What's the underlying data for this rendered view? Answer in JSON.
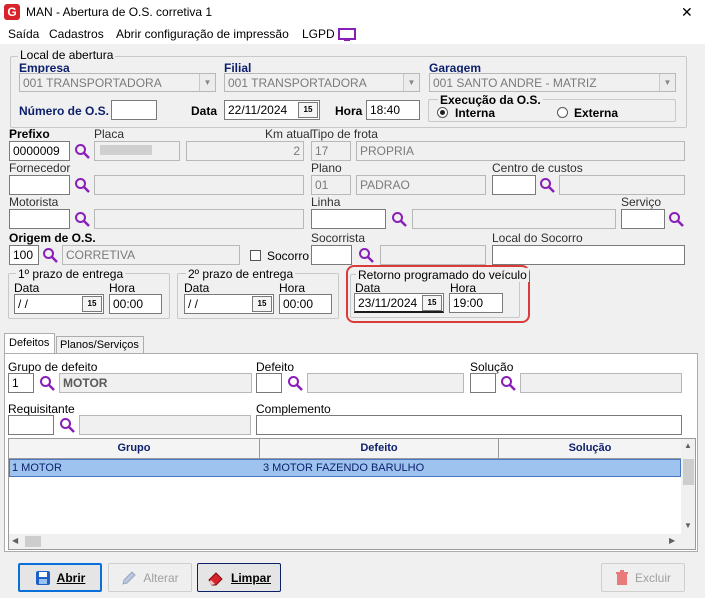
{
  "window": {
    "title": "MAN - Abertura de O.S. corretiva 1",
    "close": "✕"
  },
  "menu": [
    "Saída",
    "Cadastros",
    "Abrir configuração de impressão",
    "LGPD"
  ],
  "local": {
    "title": "Local de abertura",
    "empresa_label": "Empresa",
    "empresa_value": "001 TRANSPORTADORA",
    "filial_label": "Filial",
    "filial_value": "001 TRANSPORTADORA",
    "garagem_label": "Garagem",
    "garagem_value": "001 SANTO ANDRE - MATRIZ",
    "numero_label": "Número de O.S.",
    "numero_value": "",
    "data_label": "Data",
    "data_value": "22/11/2024",
    "hora_label": "Hora",
    "hora_value": "18:40",
    "execucao_title": "Execução da O.S.",
    "interna": "Interna",
    "externa": "Externa"
  },
  "vehicle": {
    "prefixo_label": "Prefixo",
    "prefixo_value": "0000009",
    "placa_label": "Placa",
    "placa_value": "",
    "km_label": "Km atual",
    "km_value": "2",
    "tipo_label": "Tipo de frota",
    "tipo_code": "17",
    "tipo_value": "PROPRIA",
    "fornecedor_label": "Fornecedor",
    "plano_label": "Plano",
    "plano_code": "01",
    "plano_value": "PADRAO",
    "centro_label": "Centro de custos",
    "motorista_label": "Motorista",
    "linha_label": "Linha",
    "servico_label": "Serviço",
    "origem_label": "Origem de O.S.",
    "origem_code": "100",
    "origem_value": "CORRETIVA",
    "socorro_label": "Socorro",
    "socorrista_label": "Socorrista",
    "local_socorro_label": "Local do Socorro"
  },
  "prazos": {
    "p1_title": "1º prazo de entrega",
    "p2_title": "2º prazo de entrega",
    "retorno_title": "Retorno programado do veículo",
    "data_label": "Data",
    "hora_label": "Hora",
    "p1_data": " / /",
    "p1_hora": "00:00",
    "p2_data": " / /",
    "p2_hora": "00:00",
    "ret_data": "23/11/2024",
    "ret_hora": "19:00",
    "cal": "15"
  },
  "tabs": [
    "Defeitos",
    "Planos/Serviços"
  ],
  "defeitos": {
    "grupo_label": "Grupo de defeito",
    "grupo_code": "1",
    "grupo_value": "MOTOR",
    "defeito_label": "Defeito",
    "solucao_label": "Solução",
    "requisitante_label": "Requisitante",
    "complemento_label": "Complemento",
    "columns": [
      "Grupo",
      "Defeito",
      "Solução"
    ],
    "rows": [
      {
        "grupo": "1 MOTOR",
        "defeito": "3 MOTOR FAZENDO BARULHO",
        "solucao": ""
      }
    ]
  },
  "buttons": {
    "abrir": "Abrir",
    "alterar": "Alterar",
    "limpar": "Limpar",
    "excluir": "Excluir"
  },
  "colors": {
    "highlight_red": "#d93a3a",
    "selection_blue": "#9ec3ef",
    "header_navy": "#0c1f6b"
  }
}
